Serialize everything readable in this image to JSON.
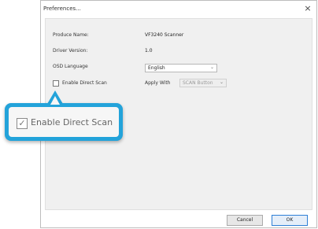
{
  "window": {
    "title": "Preferences...",
    "close_glyph": "×"
  },
  "fields": {
    "product_name_label": "Produce Name:",
    "product_name_value": "VF3240 Scanner",
    "driver_version_label": "Driver Version:",
    "driver_version_value": "1.0",
    "osd_language_label": "OSD Language",
    "osd_language_value": "English",
    "enable_direct_scan_label": "Enable Direct Scan",
    "enable_direct_scan_checked": false,
    "apply_with_label": "Apply With",
    "apply_with_value": "SCAN Button"
  },
  "buttons": {
    "cancel": "Cancel",
    "ok": "OK"
  },
  "callout": {
    "label": "Enable Direct Scan",
    "checked": true,
    "check_glyph": "✓",
    "accent_color": "#23a3da"
  },
  "icons": {
    "dropdown": "chevron-down-icon",
    "close": "close-icon"
  }
}
